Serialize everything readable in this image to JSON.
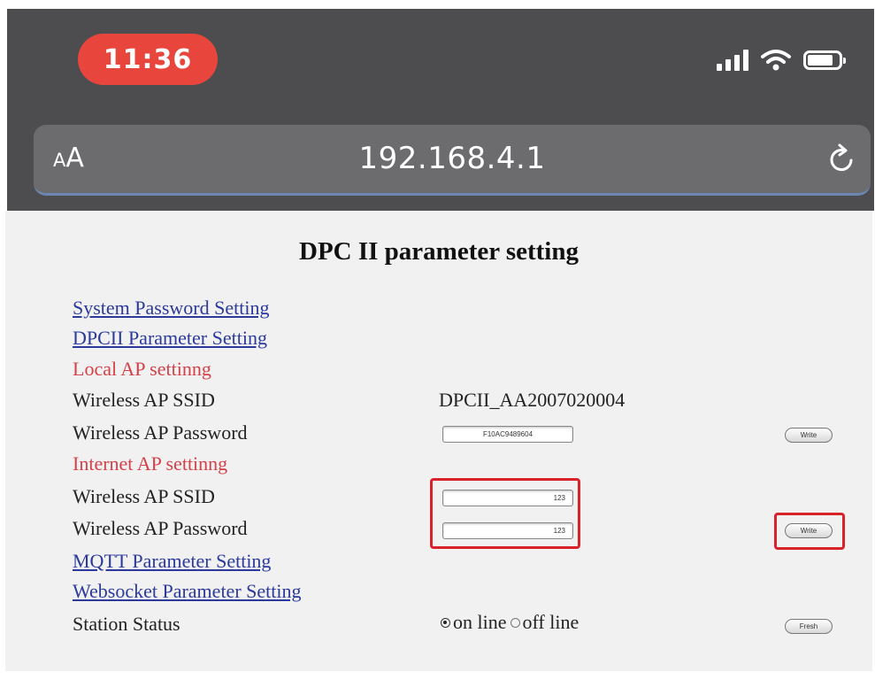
{
  "status_bar": {
    "time": "11:36",
    "icons": [
      "signal-icon",
      "wifi-icon",
      "battery-icon"
    ]
  },
  "browser": {
    "text_size_button": {
      "small": "A",
      "large": "A"
    },
    "url": "192.168.4.1",
    "reload_icon": "reload-icon"
  },
  "page": {
    "title": "DPC II parameter setting",
    "links": {
      "system_password": "System Password Setting",
      "dpcii_parameter": "DPCII Parameter Setting",
      "mqtt_parameter": "MQTT Parameter Setting",
      "websocket_parameter": "Websocket Parameter Setting"
    },
    "local_ap": {
      "section_label": "Local AP settinng",
      "ssid_label": "Wireless AP SSID",
      "ssid_value": "DPCII_AA2007020004",
      "password_label": "Wireless AP Password",
      "password_value": "F10AC9489604",
      "write_button": "Write"
    },
    "internet_ap": {
      "section_label": "Internet AP settinng",
      "ssid_label": "Wireless AP SSID",
      "ssid_value": "123",
      "password_label": "Wireless AP Password",
      "password_value": "123",
      "write_button": "Write"
    },
    "station": {
      "label": "Station Status",
      "option_online": "on line",
      "option_offline": "off line",
      "selected": "on line",
      "fresh_button": "Fresh"
    }
  },
  "colors": {
    "chrome_bg": "#4d4d4f",
    "time_pill": "#e8463d",
    "link": "#2b3a9b",
    "section_heading": "#d3424a",
    "highlight_box": "#d8232a"
  }
}
